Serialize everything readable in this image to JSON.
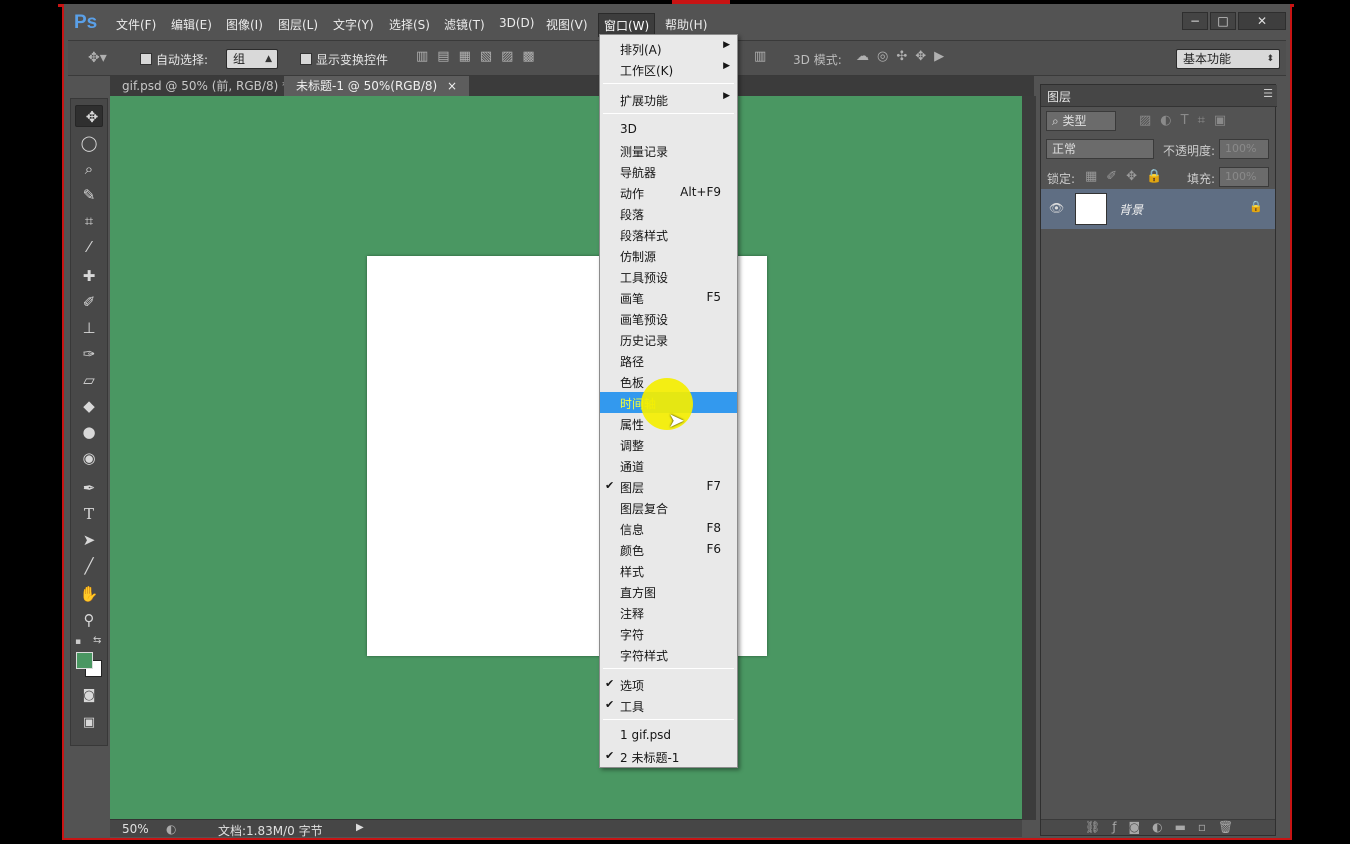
{
  "app": {
    "logo": "Ps"
  },
  "menubar": {
    "items": [
      "文件(F)",
      "编辑(E)",
      "图像(I)",
      "图层(L)",
      "文字(Y)",
      "选择(S)",
      "滤镜(T)",
      "3D(D)",
      "视图(V)",
      "窗口(W)",
      "帮助(H)"
    ],
    "active": "窗口(W)"
  },
  "window_controls": {
    "minimize": "−",
    "restore": "□",
    "close": "✕"
  },
  "options_bar": {
    "auto_select_label": "自动选择:",
    "auto_select_value": "组",
    "show_transform_label": "显示变换控件",
    "mode_3d_label": "3D 模式:",
    "workspace_value": "基本功能"
  },
  "tabs": [
    {
      "label": "gif.psd @ 50% (前, RGB/8) *",
      "active": false
    },
    {
      "label": "未标题-1 @ 50%(RGB/8)",
      "active": true
    }
  ],
  "tab_close": "×",
  "status": {
    "zoom": "50%",
    "doc_info": "文档:1.83M/0 字节"
  },
  "colors": {
    "foreground": "#4a9762",
    "background": "#ffffff",
    "canvas_bg": "#4a9762",
    "highlight": "#3399ee"
  },
  "layers_panel": {
    "title": "图层",
    "filter_label": "类型",
    "blend_mode": "正常",
    "opacity_label": "不透明度:",
    "opacity_value": "100%",
    "lock_label": "锁定:",
    "fill_label": "填充:",
    "fill_value": "100%",
    "layer_name": "背景"
  },
  "window_menu": {
    "items": [
      {
        "label": "排列(A)",
        "submenu": true
      },
      {
        "label": "工作区(K)",
        "submenu": true
      },
      {
        "sep": true
      },
      {
        "label": "扩展功能",
        "submenu": true
      },
      {
        "sep": true
      },
      {
        "label": "3D"
      },
      {
        "label": "测量记录"
      },
      {
        "label": "导航器"
      },
      {
        "label": "动作",
        "shortcut": "Alt+F9"
      },
      {
        "label": "段落"
      },
      {
        "label": "段落样式"
      },
      {
        "label": "仿制源"
      },
      {
        "label": "工具预设"
      },
      {
        "label": "画笔",
        "shortcut": "F5"
      },
      {
        "label": "画笔预设"
      },
      {
        "label": "历史记录"
      },
      {
        "label": "路径"
      },
      {
        "label": "色板"
      },
      {
        "label": "时间轴",
        "highlighted": true
      },
      {
        "label": "属性"
      },
      {
        "label": "调整"
      },
      {
        "label": "通道"
      },
      {
        "label": "图层",
        "shortcut": "F7",
        "checked": true
      },
      {
        "label": "图层复合"
      },
      {
        "label": "信息",
        "shortcut": "F8"
      },
      {
        "label": "颜色",
        "shortcut": "F6"
      },
      {
        "label": "样式"
      },
      {
        "label": "直方图"
      },
      {
        "label": "注释"
      },
      {
        "label": "字符"
      },
      {
        "label": "字符样式"
      },
      {
        "sep": true
      },
      {
        "label": "选项",
        "checked": true
      },
      {
        "label": "工具",
        "checked": true
      },
      {
        "sep": true
      },
      {
        "label": "1 gif.psd"
      },
      {
        "label": "2 未标题-1",
        "checked": true
      }
    ]
  }
}
